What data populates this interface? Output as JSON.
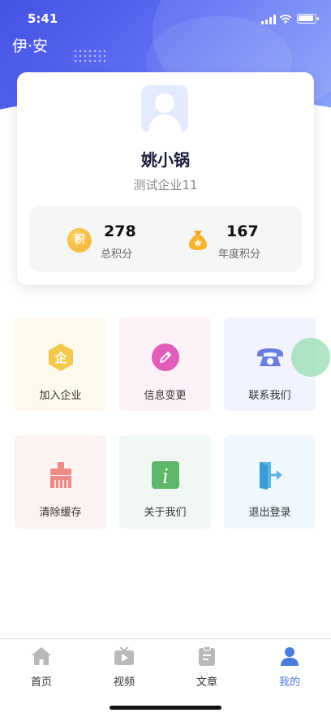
{
  "status_bar": {
    "time": "5:41"
  },
  "header": {
    "app_title": "伊·安"
  },
  "profile": {
    "name": "姚小锅",
    "company": "测试企业11",
    "total_points": {
      "value": "278",
      "label": "总积分",
      "icon_text": "积"
    },
    "year_points": {
      "value": "167",
      "label": "年度积分"
    }
  },
  "menu": {
    "row1": [
      {
        "label": "加入企业",
        "icon": "enterprise-icon",
        "icon_text": "企",
        "bg": "#fdf9ec",
        "color": "#f2c94c"
      },
      {
        "label": "信息变更",
        "icon": "edit-icon",
        "bg": "#fdf1f8",
        "color": "#e25db8"
      },
      {
        "label": "联系我们",
        "icon": "phone-icon",
        "bg": "#f1f3fe",
        "color": "#6c7de0"
      }
    ],
    "row2": [
      {
        "label": "清除缓存",
        "icon": "broom-icon",
        "bg": "#fcf2f2",
        "color": "#ec8b86"
      },
      {
        "label": "关于我们",
        "icon": "info-icon",
        "icon_text": "i",
        "bg": "#f1f8f3",
        "color": "#5cb868"
      },
      {
        "label": "退出登录",
        "icon": "logout-icon",
        "bg": "#eff8fd",
        "color": "#5fb4e6"
      }
    ]
  },
  "tab_bar": {
    "tabs": [
      {
        "label": "首页",
        "icon": "home-icon"
      },
      {
        "label": "视频",
        "icon": "video-icon"
      },
      {
        "label": "文章",
        "icon": "article-icon"
      },
      {
        "label": "我的",
        "icon": "profile-icon",
        "active": true
      }
    ],
    "active_color": "#4b7bdc",
    "inactive_color": "#b9b9b9"
  }
}
